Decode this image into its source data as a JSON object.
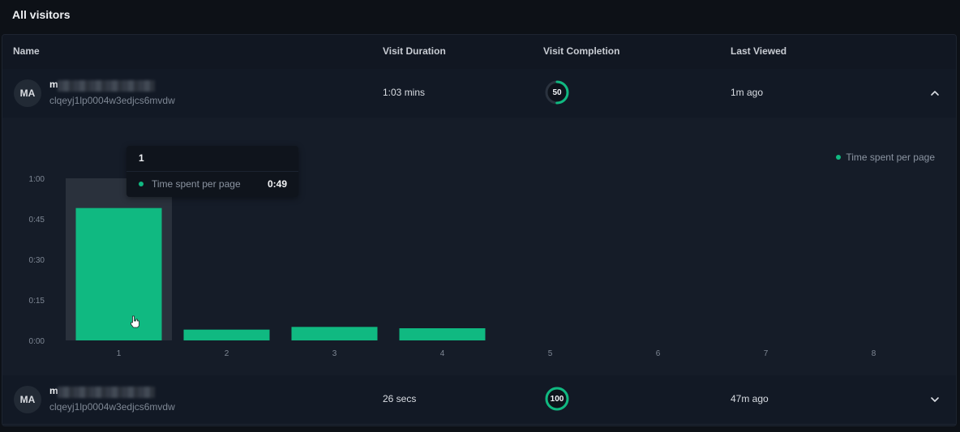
{
  "page_title": "All visitors",
  "columns": {
    "name": "Name",
    "duration": "Visit Duration",
    "completion": "Visit Completion",
    "last_viewed": "Last Viewed"
  },
  "rows": [
    {
      "avatar": "MA",
      "name_initial": "m",
      "visitor_id": "clqeyj1lp0004w3edjcs6mvdw",
      "duration": "1:03 mins",
      "completion": "50",
      "completion_value": 50,
      "last_viewed": "1m ago",
      "toggle_icon": "chevron-up-icon"
    },
    {
      "avatar": "MA",
      "name_initial": "m",
      "visitor_id": "clqeyj1lp0004w3edjcs6mvdw",
      "duration": "26 secs",
      "completion": "100",
      "completion_value": 100,
      "last_viewed": "47m ago",
      "toggle_icon": "chevron-down-icon"
    }
  ],
  "tooltip": {
    "title": "1",
    "label": "Time spent per page",
    "value": "0:49"
  },
  "colors": {
    "accent": "#10b981",
    "background": "#0d1117",
    "panel": "#151c28"
  },
  "chart_data": {
    "type": "bar",
    "categories": [
      "1",
      "2",
      "3",
      "4",
      "5",
      "6",
      "7",
      "8"
    ],
    "series": [
      {
        "name": "Time spent per page",
        "values": [
          49,
          4,
          5,
          4.5,
          0,
          0,
          0,
          0
        ]
      }
    ],
    "y_ticks": [
      "0:00",
      "0:15",
      "0:30",
      "0:45",
      "1:00"
    ],
    "ylim": [
      0,
      60
    ],
    "highlighted_category": "1",
    "legend_position": "top-right",
    "grid": false
  }
}
